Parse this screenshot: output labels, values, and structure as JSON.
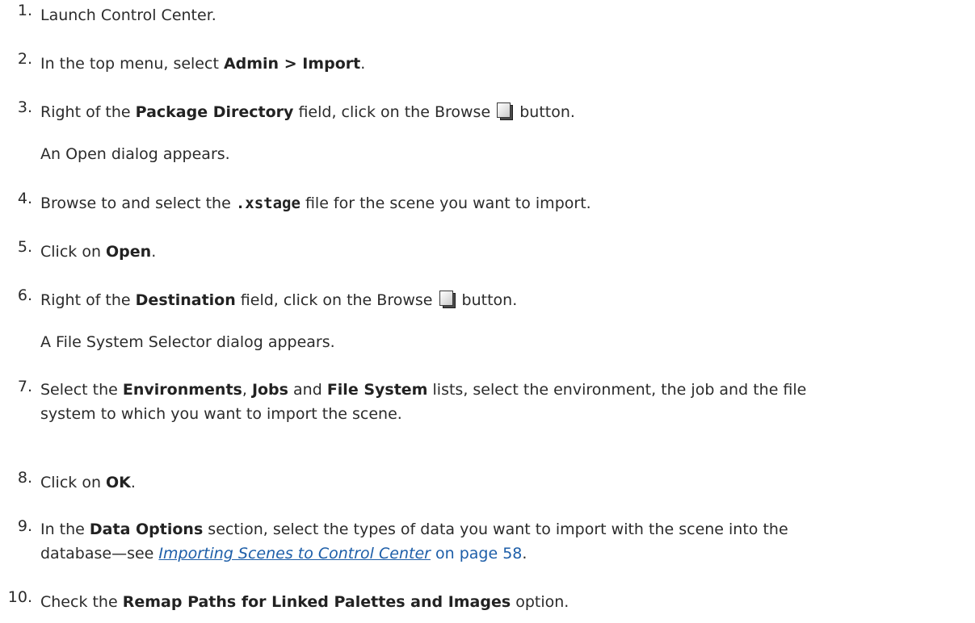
{
  "steps": [
    {
      "num": "1.",
      "text": "Launch Control Center."
    },
    {
      "num": "2.",
      "pre": "In the top menu, select ",
      "bold": "Admin > Import",
      "post": "."
    },
    {
      "num": "3.",
      "pre": "Right of the ",
      "bold": "Package Directory",
      "mid": " field, click on the Browse ",
      "post": " button.",
      "note": "An Open dialog appears.",
      "icon": "browse-icon"
    },
    {
      "num": "4.",
      "pre": "Browse to and select the ",
      "code": ".xstage",
      "post": " file for the scene you want to import."
    },
    {
      "num": "5.",
      "pre": "Click on ",
      "bold": "Open",
      "post": "."
    },
    {
      "num": "6.",
      "pre": "Right of the ",
      "bold": "Destination",
      "mid": " field, click on the Browse ",
      "post": " button.",
      "note": "A File System Selector dialog appears.",
      "icon": "browse-icon"
    },
    {
      "num": "7.",
      "pre": "Select the ",
      "bold1": "Environments",
      "sep1": ", ",
      "bold2": "Jobs",
      "sep2": " and ",
      "bold3": "File System",
      "post1": " lists, select the environment, the job and the file",
      "line2": "system to which you want to import the scene."
    },
    {
      "num": "8.",
      "pre": "Click on ",
      "bold": "OK",
      "post": "."
    },
    {
      "num": "9.",
      "pre": "In the ",
      "bold": "Data Options",
      "post1": " section, select the types of data you want to import with the scene into the",
      "line2_pre": "database—see ",
      "link": "Importing Scenes to Control Center",
      "link_post": " on page 58",
      "line2_post": "."
    },
    {
      "num": "10.",
      "pre": "Check the ",
      "bold": "Remap Paths for Linked Palettes and Images",
      "post": " option."
    }
  ],
  "colors": {
    "text": "#2b2b2b",
    "link": "#1d5ea8"
  }
}
